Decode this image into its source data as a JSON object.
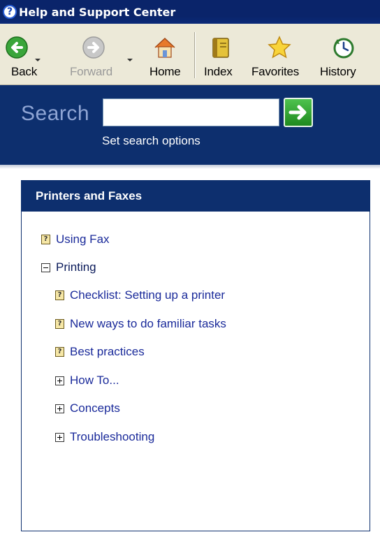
{
  "window": {
    "title": "Help and Support Center"
  },
  "toolbar": {
    "back": "Back",
    "forward": "Forward",
    "home": "Home",
    "index": "Index",
    "favorites": "Favorites",
    "history": "History"
  },
  "search": {
    "label": "Search",
    "value": "",
    "options_link": "Set search options"
  },
  "panel": {
    "title": "Printers and Faxes",
    "items": [
      {
        "label": "Using Fax",
        "icon": "help-topic-icon"
      },
      {
        "label": "Printing",
        "icon": "collapse-icon"
      },
      {
        "label": "Checklist: Setting up a printer",
        "icon": "help-topic-icon"
      },
      {
        "label": "New ways to do familiar tasks",
        "icon": "help-topic-icon"
      },
      {
        "label": "Best practices",
        "icon": "help-topic-icon"
      },
      {
        "label": "How To...",
        "icon": "expand-icon"
      },
      {
        "label": "Concepts",
        "icon": "expand-icon"
      },
      {
        "label": "Troubleshooting",
        "icon": "expand-icon"
      }
    ]
  },
  "colors": {
    "title_bar": "#0a246a",
    "band": "#0d2f6e",
    "link": "#1a2a9a"
  }
}
